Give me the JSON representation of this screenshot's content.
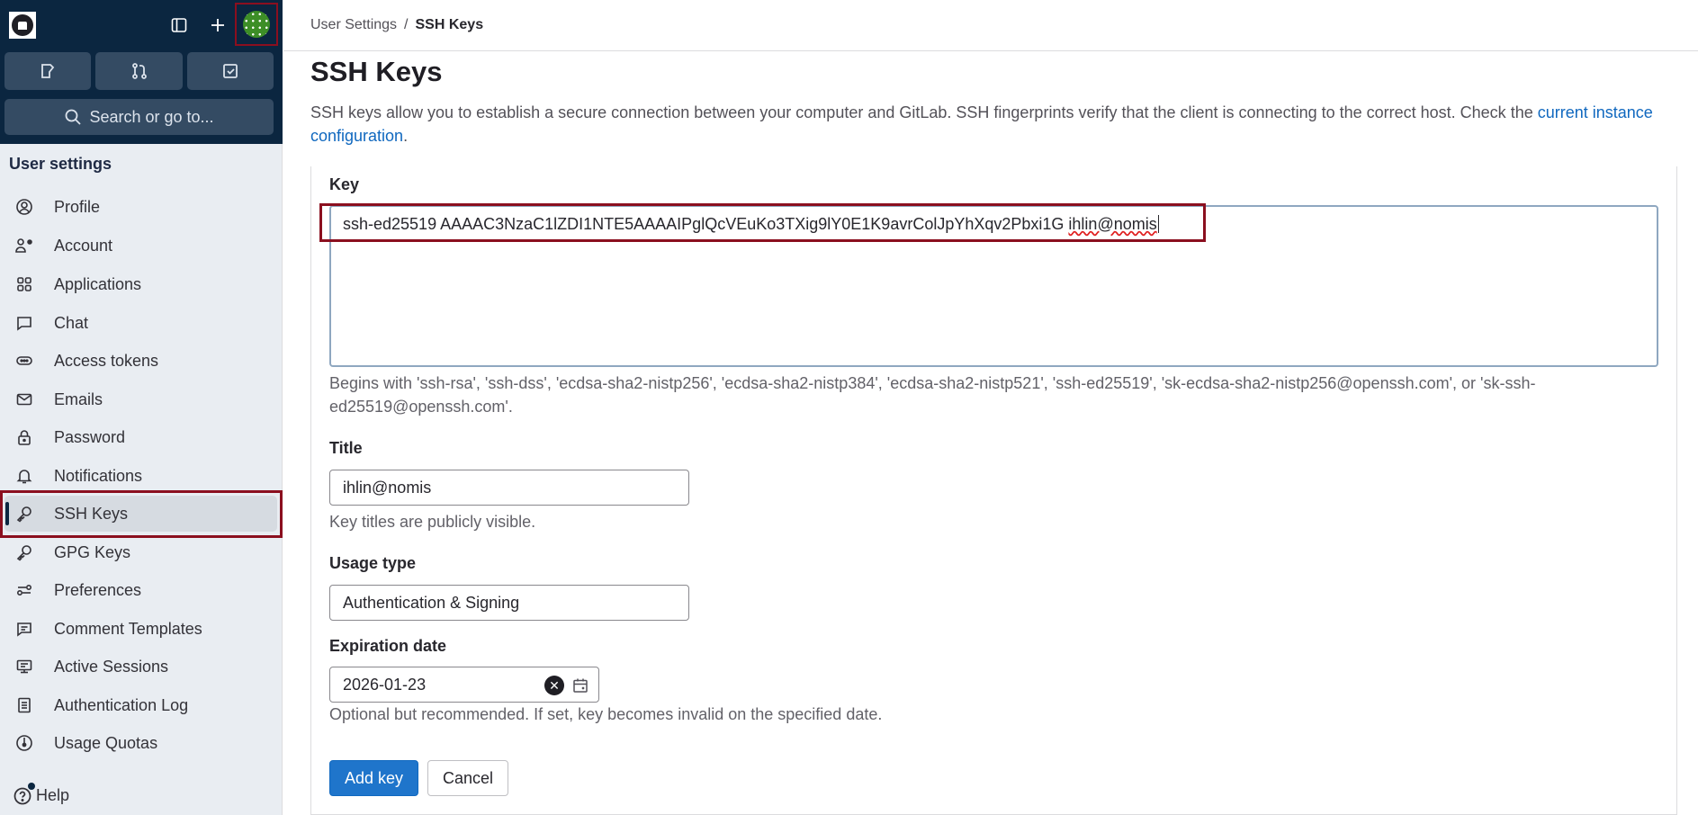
{
  "sidebar": {
    "search_placeholder": "Search or go to...",
    "section_title": "User settings",
    "items": [
      {
        "label": "Profile",
        "icon": "profile-icon"
      },
      {
        "label": "Account",
        "icon": "account-icon"
      },
      {
        "label": "Applications",
        "icon": "applications-icon"
      },
      {
        "label": "Chat",
        "icon": "chat-icon"
      },
      {
        "label": "Access tokens",
        "icon": "token-icon"
      },
      {
        "label": "Emails",
        "icon": "mail-icon"
      },
      {
        "label": "Password",
        "icon": "lock-icon"
      },
      {
        "label": "Notifications",
        "icon": "bell-icon"
      },
      {
        "label": "SSH Keys",
        "icon": "key-icon",
        "active": true
      },
      {
        "label": "GPG Keys",
        "icon": "key-icon"
      },
      {
        "label": "Preferences",
        "icon": "preferences-icon"
      },
      {
        "label": "Comment Templates",
        "icon": "comment-icon"
      },
      {
        "label": "Active Sessions",
        "icon": "monitor-icon"
      },
      {
        "label": "Authentication Log",
        "icon": "log-icon"
      },
      {
        "label": "Usage Quotas",
        "icon": "quota-icon"
      }
    ],
    "help_label": "Help"
  },
  "breadcrumb": {
    "parent": "User Settings",
    "separator": "/",
    "current": "SSH Keys"
  },
  "page": {
    "title": "SSH Keys",
    "description": "SSH keys allow you to establish a secure connection between your computer and GitLab. SSH fingerprints verify that the client is connecting to the correct host. Check the ",
    "description_link": "current instance configuration",
    "description_end": "."
  },
  "form": {
    "key_label": "Key",
    "key_value_main": "ssh-ed25519 AAAAC3NzaC1lZDI1NTE5AAAAIPglQcVEuKo3TXig9lY0E1K9avrColJpYhXqv2Pbxi1G ",
    "key_value_comment": "ihlin@nomis",
    "key_help": "Begins with 'ssh-rsa', 'ssh-dss', 'ecdsa-sha2-nistp256', 'ecdsa-sha2-nistp384', 'ecdsa-sha2-nistp521', 'ssh-ed25519', 'sk-ecdsa-sha2-nistp256@openssh.com', or 'sk-ssh-ed25519@openssh.com'.",
    "title_label": "Title",
    "title_value": "ihlin@nomis",
    "title_help": "Key titles are publicly visible.",
    "usage_label": "Usage type",
    "usage_value": "Authentication & Signing",
    "expiration_label": "Expiration date",
    "expiration_value": "2026-01-23",
    "expiration_help": "Optional but recommended. If set, key becomes invalid on the specified date.",
    "add_button": "Add key",
    "cancel_button": "Cancel"
  },
  "colors": {
    "primary": "#1f75cb",
    "sidebar_dark": "#0b2640",
    "highlight": "#8b0f1f",
    "link": "#1068bf"
  }
}
